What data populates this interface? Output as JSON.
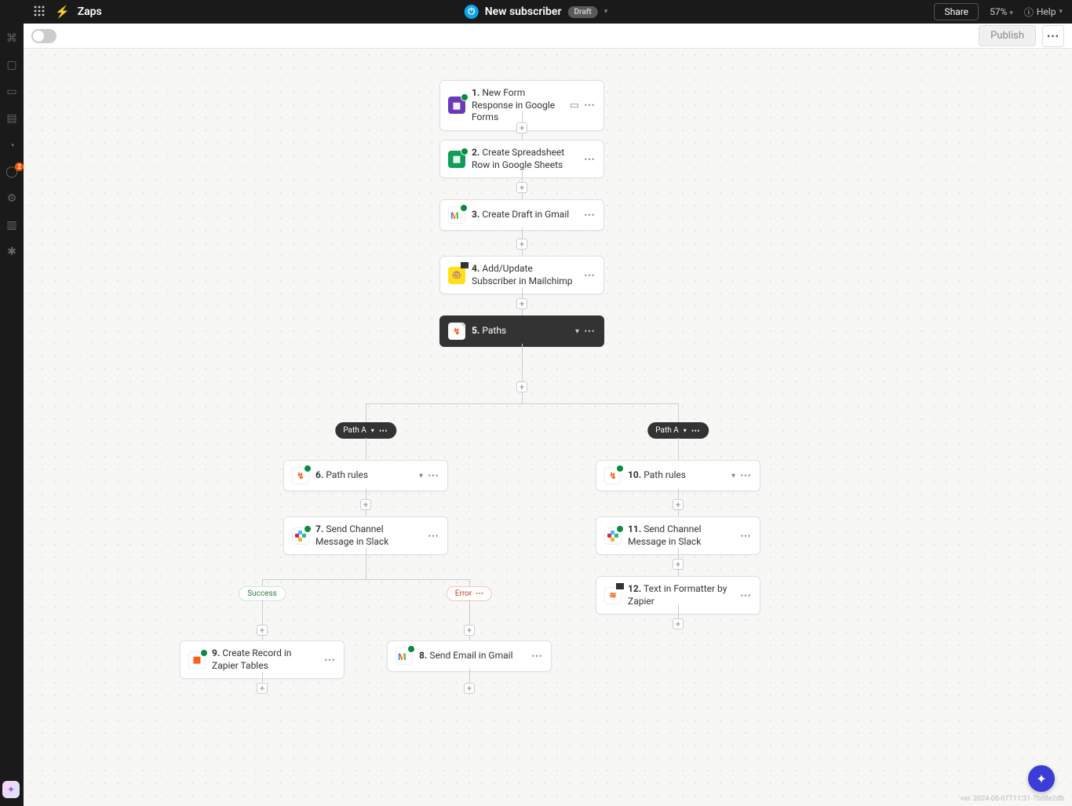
{
  "header": {
    "app_label": "Zaps",
    "zap_name": "New subscriber",
    "status_badge": "Draft",
    "share_label": "Share",
    "zoom": "57%",
    "help_label": "Help"
  },
  "subbar": {
    "publish_label": "Publish"
  },
  "leftrail": {
    "badge_count": "2"
  },
  "path_labels": {
    "path_a_left": "Path A",
    "path_a_right": "Path A",
    "success": "Success",
    "error": "Error"
  },
  "steps": {
    "s1": {
      "num": "1.",
      "title": "New Form Response in Google Forms"
    },
    "s2": {
      "num": "2.",
      "title": "Create Spreadsheet Row in Google Sheets"
    },
    "s3": {
      "num": "3.",
      "title": "Create Draft in Gmail"
    },
    "s4": {
      "num": "4.",
      "title": "Add/Update Subscriber in Mailchimp"
    },
    "s5": {
      "num": "5.",
      "title": "Paths"
    },
    "s6": {
      "num": "6.",
      "title": "Path rules"
    },
    "s7": {
      "num": "7.",
      "title": "Send Channel Message in Slack"
    },
    "s8": {
      "num": "8.",
      "title": "Send Email in Gmail"
    },
    "s9": {
      "num": "9.",
      "title": "Create Record in Zapier Tables"
    },
    "s10": {
      "num": "10.",
      "title": "Path rules"
    },
    "s11": {
      "num": "11.",
      "title": "Send Channel Message in Slack"
    },
    "s12": {
      "num": "12.",
      "title": "Text in Formatter by Zapier"
    }
  },
  "footer": {
    "version": "ver. 2024-06-07T11:31-7bd8e2db"
  }
}
